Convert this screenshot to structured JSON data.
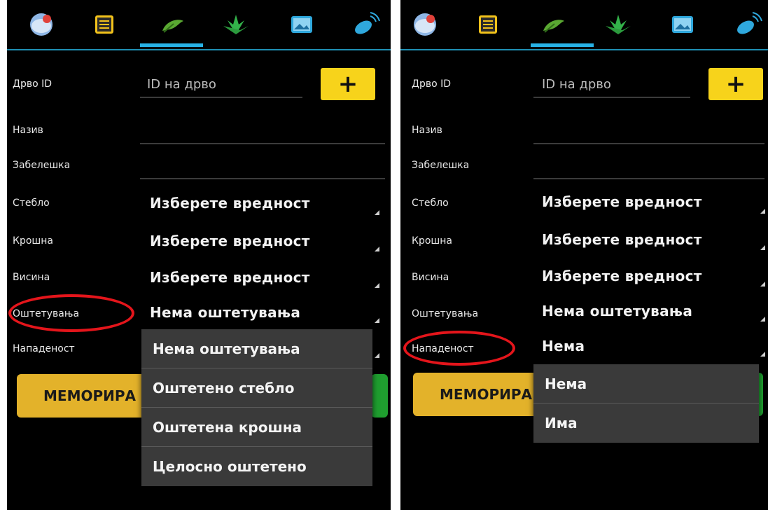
{
  "left": {
    "tabs": [
      "globe-icon",
      "list-icon",
      "leaf-icon",
      "plant-icon",
      "image-icon",
      "satellite-icon"
    ],
    "active_tab_index": 2,
    "fields": {
      "tree_id_label": "Дрво ID",
      "tree_id_placeholder": "ID на дрво",
      "add_button": "+",
      "name_label": "Назив",
      "note_label": "Забелешка",
      "trunk_label": "Стебло",
      "trunk_value": "Изберете вредност",
      "crown_label": "Крошна",
      "crown_value": "Изберете вредност",
      "height_label": "Висина",
      "height_value": "Изберете вредност",
      "damage_label": "Оштетувања",
      "damage_value": "Нема оштетувања",
      "infestation_label": "Нападеност"
    },
    "save_button": "МЕМОРИРА",
    "dropdown_options": [
      "Нема оштетувања",
      "Оштетено стебло",
      "Оштетена крошна",
      "Целосно оштетено"
    ]
  },
  "right": {
    "tabs": [
      "globe-icon",
      "list-icon",
      "leaf-icon",
      "plant-icon",
      "image-icon",
      "satellite-icon"
    ],
    "active_tab_index": 2,
    "fields": {
      "tree_id_label": "Дрво ID",
      "tree_id_placeholder": "ID на дрво",
      "add_button": "+",
      "name_label": "Назив",
      "note_label": "Забелешка",
      "trunk_label": "Стебло",
      "trunk_value": "Изберете вредност",
      "crown_label": "Крошна",
      "crown_value": "Изберете вредност",
      "height_label": "Висина",
      "height_value": "Изберете вредност",
      "damage_label": "Оштетувања",
      "damage_value": "Нема оштетувања",
      "infestation_label": "Нападеност",
      "infestation_value": "Нема"
    },
    "save_button": "МЕМОРИРА",
    "dropdown_options": [
      "Нема",
      "Има"
    ]
  },
  "colors": {
    "accent_yellow": "#f7d31b",
    "save_yellow": "#e3b22a",
    "tab_underline": "#27b2e6",
    "highlight_red": "#e4151b",
    "green": "#1f9e2f"
  }
}
